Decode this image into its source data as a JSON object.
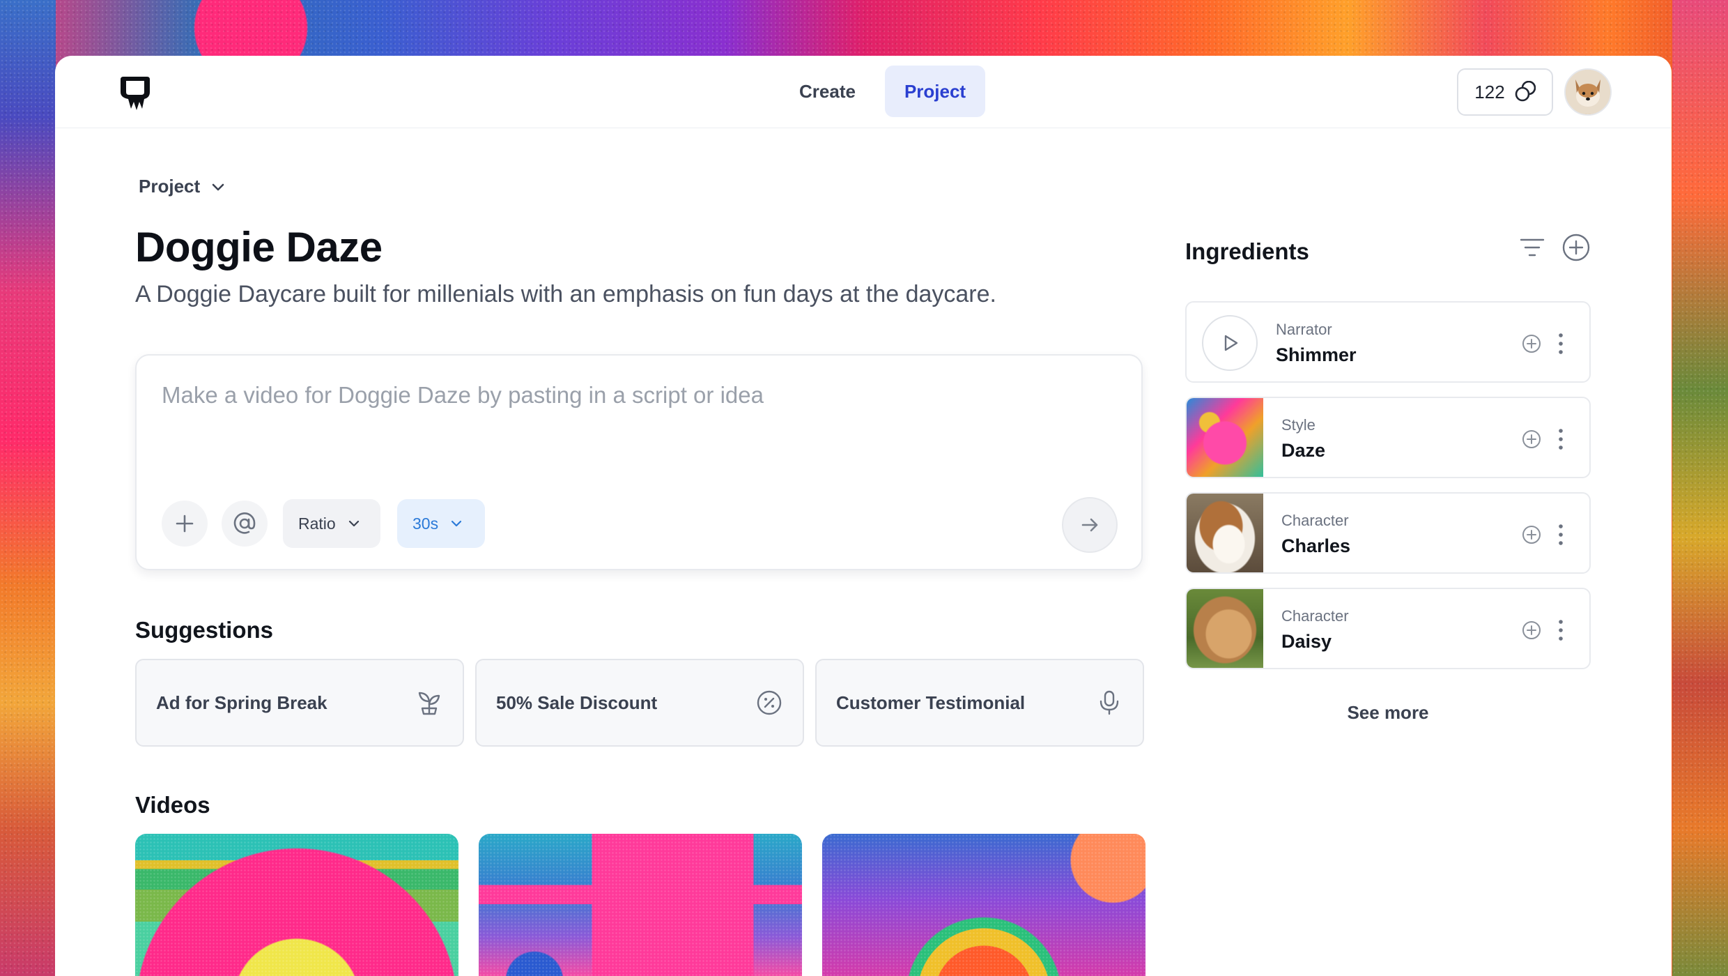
{
  "colors": {
    "accent": "#2a3fd0",
    "accent_bg": "#e8edfc",
    "duration_text": "#2b7ad8",
    "duration_bg": "#e6f0fd"
  },
  "header": {
    "logo_icon": "brand-logo-icon",
    "nav": [
      {
        "label": "Create",
        "active": false
      },
      {
        "label": "Project",
        "active": true
      }
    ],
    "credits": {
      "count": "122",
      "icon": "credits-icon"
    },
    "avatar_icon": "user-avatar"
  },
  "main": {
    "project_selector": {
      "label": "Project",
      "icon": "chevron-down-icon"
    },
    "title": "Doggie Daze",
    "description": "A Doggie Daycare built for millenials with an emphasis on fun days at the daycare.",
    "prompt": {
      "placeholder": "Make a video for Doggie Daze by pasting in a script or idea",
      "value": "",
      "ratio_label": "Ratio",
      "duration_label": "30s"
    },
    "suggestions_title": "Suggestions",
    "suggestions": [
      {
        "label": "Ad for Spring Break",
        "icon": "sprout-icon"
      },
      {
        "label": "50% Sale Discount",
        "icon": "percent-icon"
      },
      {
        "label": "Customer Testimonial",
        "icon": "microphone-icon"
      }
    ],
    "videos_title": "Videos"
  },
  "ingredients": {
    "title": "Ingredients",
    "items": [
      {
        "kind": "Narrator",
        "name": "Shimmer"
      },
      {
        "kind": "Style",
        "name": "Daze"
      },
      {
        "kind": "Character",
        "name": "Charles"
      },
      {
        "kind": "Character",
        "name": "Daisy"
      }
    ],
    "see_more": "See more"
  }
}
